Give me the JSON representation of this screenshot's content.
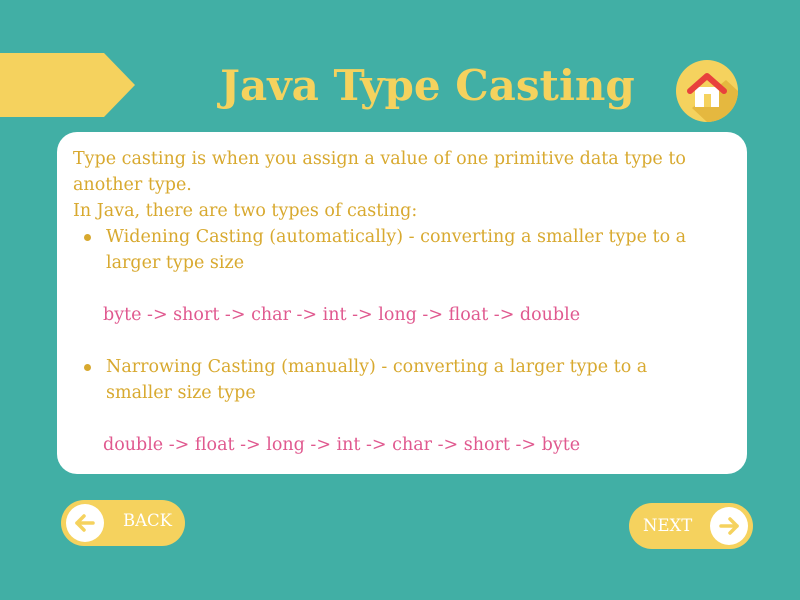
{
  "header": {
    "title": "Java Type Casting",
    "home_icon": "home-icon"
  },
  "content": {
    "intro": [
      "Type casting is when you assign a value of one primitive data type to",
      "another type.",
      "In Java, there are two types of casting:"
    ],
    "items": [
      {
        "lines": [
          "Widening Casting (automatically) - converting a smaller type to a",
          "larger type size"
        ],
        "example": "byte -> short -> char -> int -> long -> float -> double"
      },
      {
        "lines": [
          "Narrowing Casting (manually) - converting a larger type to a",
          "smaller size type"
        ],
        "example": "double -> float -> long -> int -> char -> short -> byte"
      }
    ]
  },
  "nav": {
    "back_label": "BACK",
    "back_icon": "arrow-left-icon",
    "next_label": "NEXT",
    "next_icon": "arrow-right-icon"
  },
  "colors": {
    "background": "#41afa5",
    "accent_yellow": "#f5d25e",
    "text_gold": "#d8a92f",
    "code_pink": "#e0598f",
    "home_roof_red": "#e8413c",
    "card_white": "#ffffff"
  }
}
